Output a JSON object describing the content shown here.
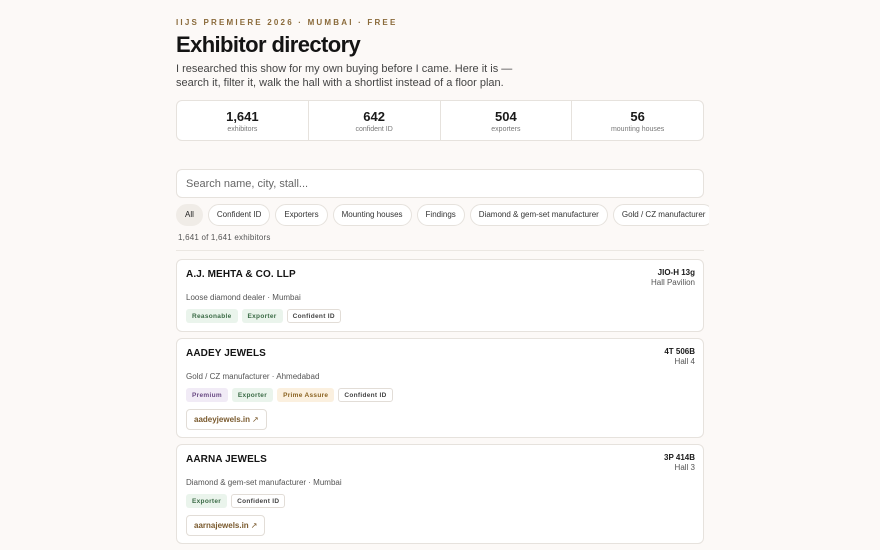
{
  "header": {
    "eyebrow": "IIJS PREMIERE 2026 · MUMBAI · FREE",
    "title": "Exhibitor directory",
    "intro": "I researched this show for my own buying before I came. Here it is — search it, filter it, walk the hall with a shortlist instead of a floor plan."
  },
  "stats": [
    {
      "value": "1,641",
      "label": "exhibitors"
    },
    {
      "value": "642",
      "label": "confident ID"
    },
    {
      "value": "504",
      "label": "exporters"
    },
    {
      "value": "56",
      "label": "mounting houses"
    }
  ],
  "search": {
    "placeholder": "Search name, city, stall...",
    "value": ""
  },
  "filters": [
    {
      "label": "All",
      "active": true
    },
    {
      "label": "Confident ID",
      "active": false
    },
    {
      "label": "Exporters",
      "active": false
    },
    {
      "label": "Mounting houses",
      "active": false
    },
    {
      "label": "Findings",
      "active": false
    },
    {
      "label": "Diamond & gem-set manufacturer",
      "active": false
    },
    {
      "label": "Gold / CZ manufacturer",
      "active": false
    }
  ],
  "result_count": "1,641 of 1,641 exhibitors",
  "exhibitors": [
    {
      "name": "A.J. MEHTA & CO. LLP",
      "stall": "JIO-H 13g",
      "hall": "Hall Pavilion",
      "meta": "Loose diamond dealer · Mumbai",
      "badges": [
        {
          "label": "Reasonable",
          "kind": "reasonable"
        },
        {
          "label": "Exporter",
          "kind": "exporter"
        },
        {
          "label": "Confident ID",
          "kind": "confident"
        }
      ],
      "website": ""
    },
    {
      "name": "AADEY JEWELS",
      "stall": "4T 506B",
      "hall": "Hall 4",
      "meta": "Gold / CZ manufacturer · Ahmedabad",
      "badges": [
        {
          "label": "Premium",
          "kind": "premium"
        },
        {
          "label": "Exporter",
          "kind": "exporter"
        },
        {
          "label": "Prime Assure",
          "kind": "prime"
        },
        {
          "label": "Confident ID",
          "kind": "confident"
        }
      ],
      "website": "aadeyjewels.in"
    },
    {
      "name": "AARNA JEWELS",
      "stall": "3P 414B",
      "hall": "Hall 3",
      "meta": "Diamond & gem-set manufacturer · Mumbai",
      "badges": [
        {
          "label": "Exporter",
          "kind": "exporter"
        },
        {
          "label": "Confident ID",
          "kind": "confident"
        }
      ],
      "website": "aarnajewels.in"
    }
  ],
  "icons": {
    "external_link": "external-link-icon"
  },
  "colors": {
    "accent": "#8a6a3a",
    "page_bg": "#fcf9f7"
  }
}
